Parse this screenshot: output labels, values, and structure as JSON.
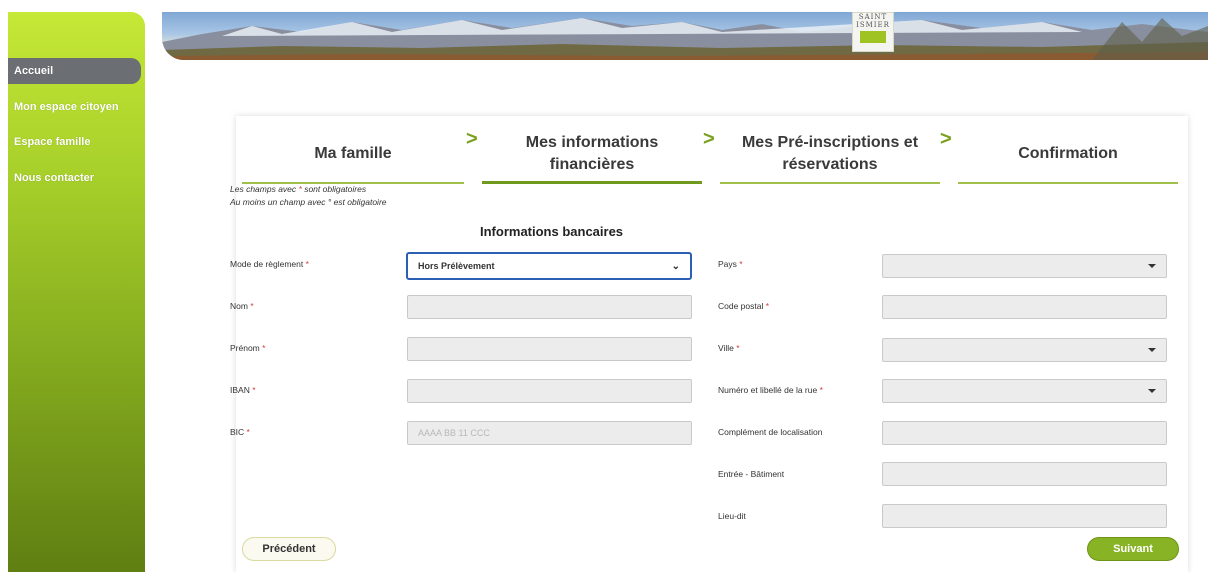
{
  "sidebar": {
    "items": [
      {
        "label": "Accueil",
        "active": true
      },
      {
        "label": "Mon espace citoyen",
        "active": false
      },
      {
        "label": "Espace famille",
        "active": false
      },
      {
        "label": "Nous contacter",
        "active": false
      }
    ]
  },
  "banner": {
    "logo_line1": "SAINT",
    "logo_line2": "ISMIER"
  },
  "steps": [
    {
      "label_line1": "Ma famille",
      "label_line2": "",
      "active": false
    },
    {
      "label_line1": "Mes informations",
      "label_line2": "financières",
      "active": true
    },
    {
      "label_line1": "Mes Pré-inscriptions et",
      "label_line2": "réservations",
      "active": false
    },
    {
      "label_line1": "Confirmation",
      "label_line2": "",
      "active": false
    }
  ],
  "hints": {
    "required_prefix": "Les champs avec ",
    "required_star": "*",
    "required_suffix": " sont obligatoires",
    "one_prefix": "Au moins un champ avec ",
    "one_star": "°",
    "one_suffix": " est obligatoire"
  },
  "section_title": "Informations bancaires",
  "left_fields": {
    "mode_label": "Mode de règlement",
    "mode_value": "Hors Prélèvement",
    "nom_label": "Nom",
    "prenom_label": "Prénom",
    "iban_label": "IBAN",
    "bic_label": "BIC",
    "bic_placeholder": "AAAA BB 11 CCC"
  },
  "right_fields": {
    "pays_label": "Pays",
    "cp_label": "Code postal",
    "ville_label": "Ville",
    "rue_label": "Numéro et libellé de la rue",
    "complement_label": "Complément de localisation",
    "entree_label": "Entrée - Bâtiment",
    "lieu_label": "Lieu-dit"
  },
  "required_star": "*",
  "buttons": {
    "prev": "Précédent",
    "next": "Suivant"
  },
  "colors": {
    "accent_green": "#88b324",
    "sidebar_active": "#6b6f73",
    "focus_blue": "#2b5fb3",
    "required_red": "#d04040"
  }
}
